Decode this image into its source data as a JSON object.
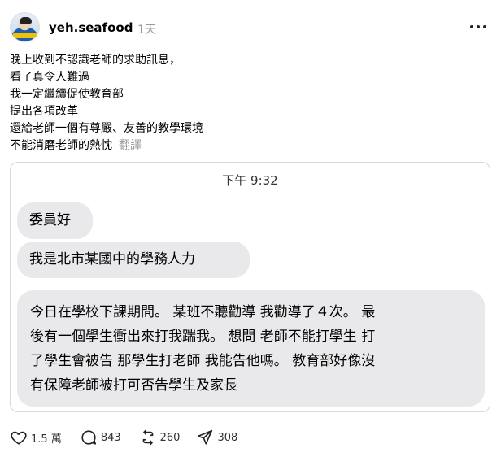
{
  "post": {
    "username": "yeh.seafood",
    "time": "1天",
    "body_lines": [
      "晚上收到不認識老師的求助訊息，",
      "看了真令人難過",
      "我一定繼續促使教育部",
      "提出各項改革",
      "還給老師一個有尊嚴、友善的教學環境",
      "不能消磨老師的熱忱"
    ],
    "translate_label": "翻譯"
  },
  "attachment": {
    "chat_time": "下午 9:32",
    "bubbles": [
      "委員好",
      "我是北市某國中的學務人力"
    ],
    "long_bubble_lines": [
      "今日在學校下課期間。 某班不聽勸導 我勸導了４次。 最",
      "後有一個學生衝出來打我踹我。 想問 老師不能打學生 打",
      "了學生會被告 那學生打老師 我能告他嗎。 教育部好像沒",
      "有保障老師被打可否告學生及家長"
    ]
  },
  "actions": {
    "likes": "1.5 萬",
    "comments": "843",
    "reposts": "260",
    "shares": "308"
  },
  "icons": {
    "like": "heart-icon",
    "comment": "comment-bubble-icon",
    "repost": "repost-icon",
    "share": "send-icon",
    "more": "more-dots-icon"
  }
}
